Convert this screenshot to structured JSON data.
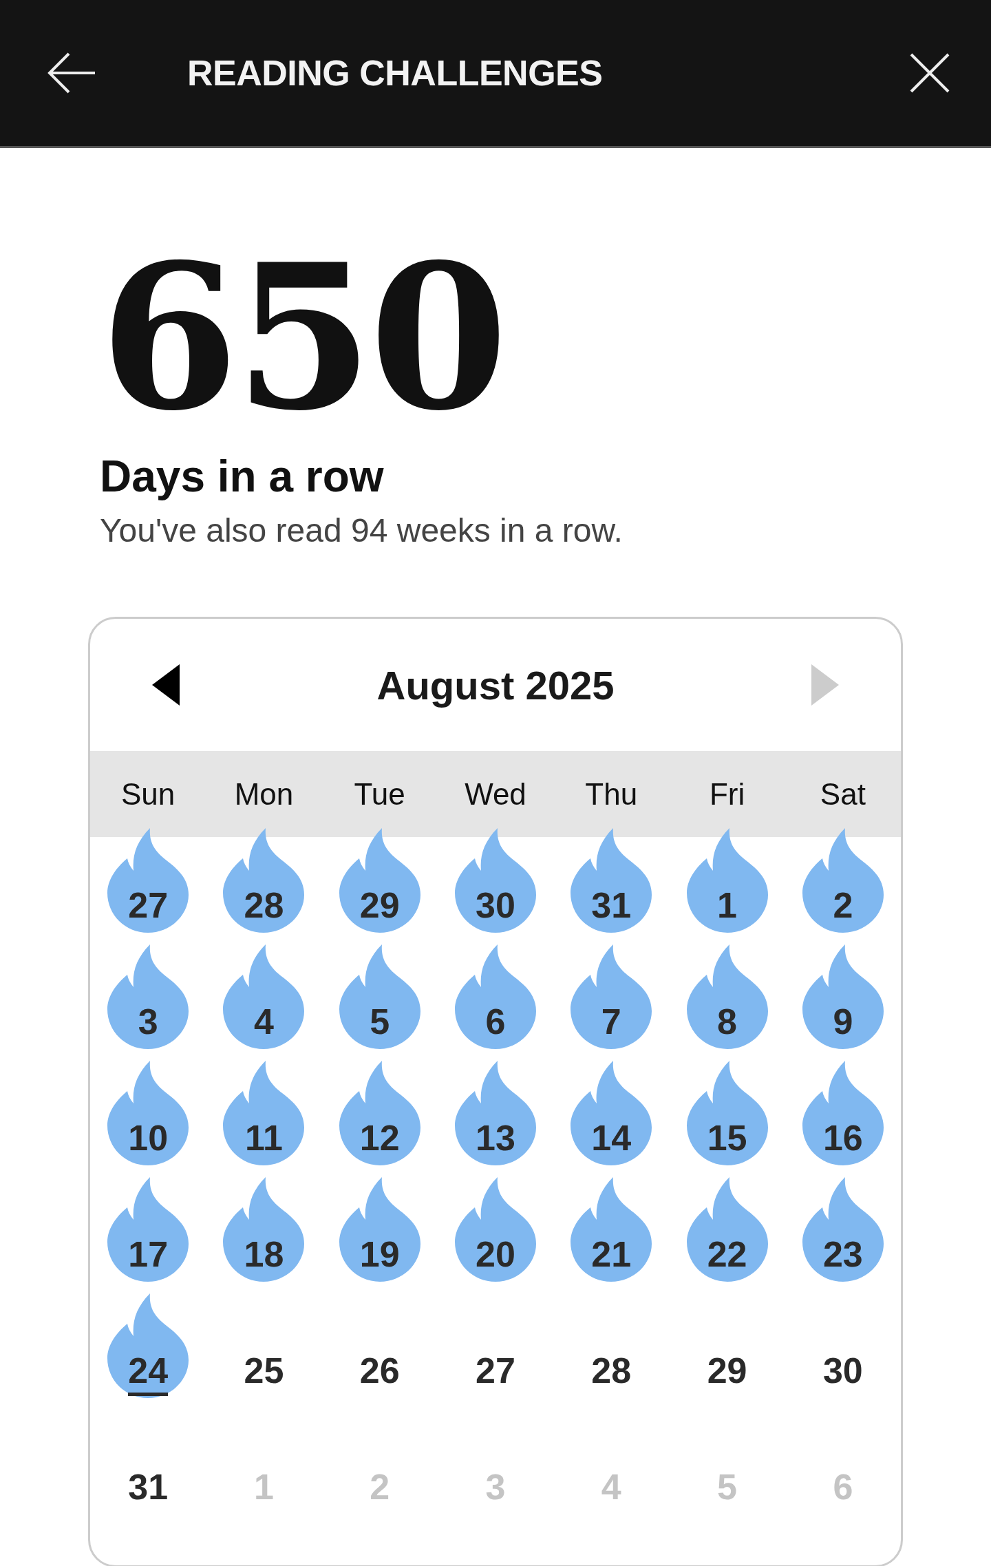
{
  "header": {
    "title": "READING CHALLENGES"
  },
  "streak": {
    "count": "650",
    "label": "Days in a row",
    "subtitle": "You've also read 94 weeks in a row."
  },
  "calendar": {
    "month": "August 2025",
    "prev_disabled": false,
    "next_disabled": true,
    "weekdays": [
      "Sun",
      "Mon",
      "Tue",
      "Wed",
      "Thu",
      "Fri",
      "Sat"
    ],
    "days": [
      {
        "day": "27",
        "streak": true,
        "today": false,
        "outside": false
      },
      {
        "day": "28",
        "streak": true,
        "today": false,
        "outside": false
      },
      {
        "day": "29",
        "streak": true,
        "today": false,
        "outside": false
      },
      {
        "day": "30",
        "streak": true,
        "today": false,
        "outside": false
      },
      {
        "day": "31",
        "streak": true,
        "today": false,
        "outside": false
      },
      {
        "day": "1",
        "streak": true,
        "today": false,
        "outside": false
      },
      {
        "day": "2",
        "streak": true,
        "today": false,
        "outside": false
      },
      {
        "day": "3",
        "streak": true,
        "today": false,
        "outside": false
      },
      {
        "day": "4",
        "streak": true,
        "today": false,
        "outside": false
      },
      {
        "day": "5",
        "streak": true,
        "today": false,
        "outside": false
      },
      {
        "day": "6",
        "streak": true,
        "today": false,
        "outside": false
      },
      {
        "day": "7",
        "streak": true,
        "today": false,
        "outside": false
      },
      {
        "day": "8",
        "streak": true,
        "today": false,
        "outside": false
      },
      {
        "day": "9",
        "streak": true,
        "today": false,
        "outside": false
      },
      {
        "day": "10",
        "streak": true,
        "today": false,
        "outside": false
      },
      {
        "day": "11",
        "streak": true,
        "today": false,
        "outside": false
      },
      {
        "day": "12",
        "streak": true,
        "today": false,
        "outside": false
      },
      {
        "day": "13",
        "streak": true,
        "today": false,
        "outside": false
      },
      {
        "day": "14",
        "streak": true,
        "today": false,
        "outside": false
      },
      {
        "day": "15",
        "streak": true,
        "today": false,
        "outside": false
      },
      {
        "day": "16",
        "streak": true,
        "today": false,
        "outside": false
      },
      {
        "day": "17",
        "streak": true,
        "today": false,
        "outside": false
      },
      {
        "day": "18",
        "streak": true,
        "today": false,
        "outside": false
      },
      {
        "day": "19",
        "streak": true,
        "today": false,
        "outside": false
      },
      {
        "day": "20",
        "streak": true,
        "today": false,
        "outside": false
      },
      {
        "day": "21",
        "streak": true,
        "today": false,
        "outside": false
      },
      {
        "day": "22",
        "streak": true,
        "today": false,
        "outside": false
      },
      {
        "day": "23",
        "streak": true,
        "today": false,
        "outside": false
      },
      {
        "day": "24",
        "streak": true,
        "today": true,
        "outside": false
      },
      {
        "day": "25",
        "streak": false,
        "today": false,
        "outside": false
      },
      {
        "day": "26",
        "streak": false,
        "today": false,
        "outside": false
      },
      {
        "day": "27",
        "streak": false,
        "today": false,
        "outside": false
      },
      {
        "day": "28",
        "streak": false,
        "today": false,
        "outside": false
      },
      {
        "day": "29",
        "streak": false,
        "today": false,
        "outside": false
      },
      {
        "day": "30",
        "streak": false,
        "today": false,
        "outside": false
      },
      {
        "day": "31",
        "streak": false,
        "today": false,
        "outside": false
      },
      {
        "day": "1",
        "streak": false,
        "today": false,
        "outside": true
      },
      {
        "day": "2",
        "streak": false,
        "today": false,
        "outside": true
      },
      {
        "day": "3",
        "streak": false,
        "today": false,
        "outside": true
      },
      {
        "day": "4",
        "streak": false,
        "today": false,
        "outside": true
      },
      {
        "day": "5",
        "streak": false,
        "today": false,
        "outside": true
      },
      {
        "day": "6",
        "streak": false,
        "today": false,
        "outside": true
      }
    ]
  }
}
